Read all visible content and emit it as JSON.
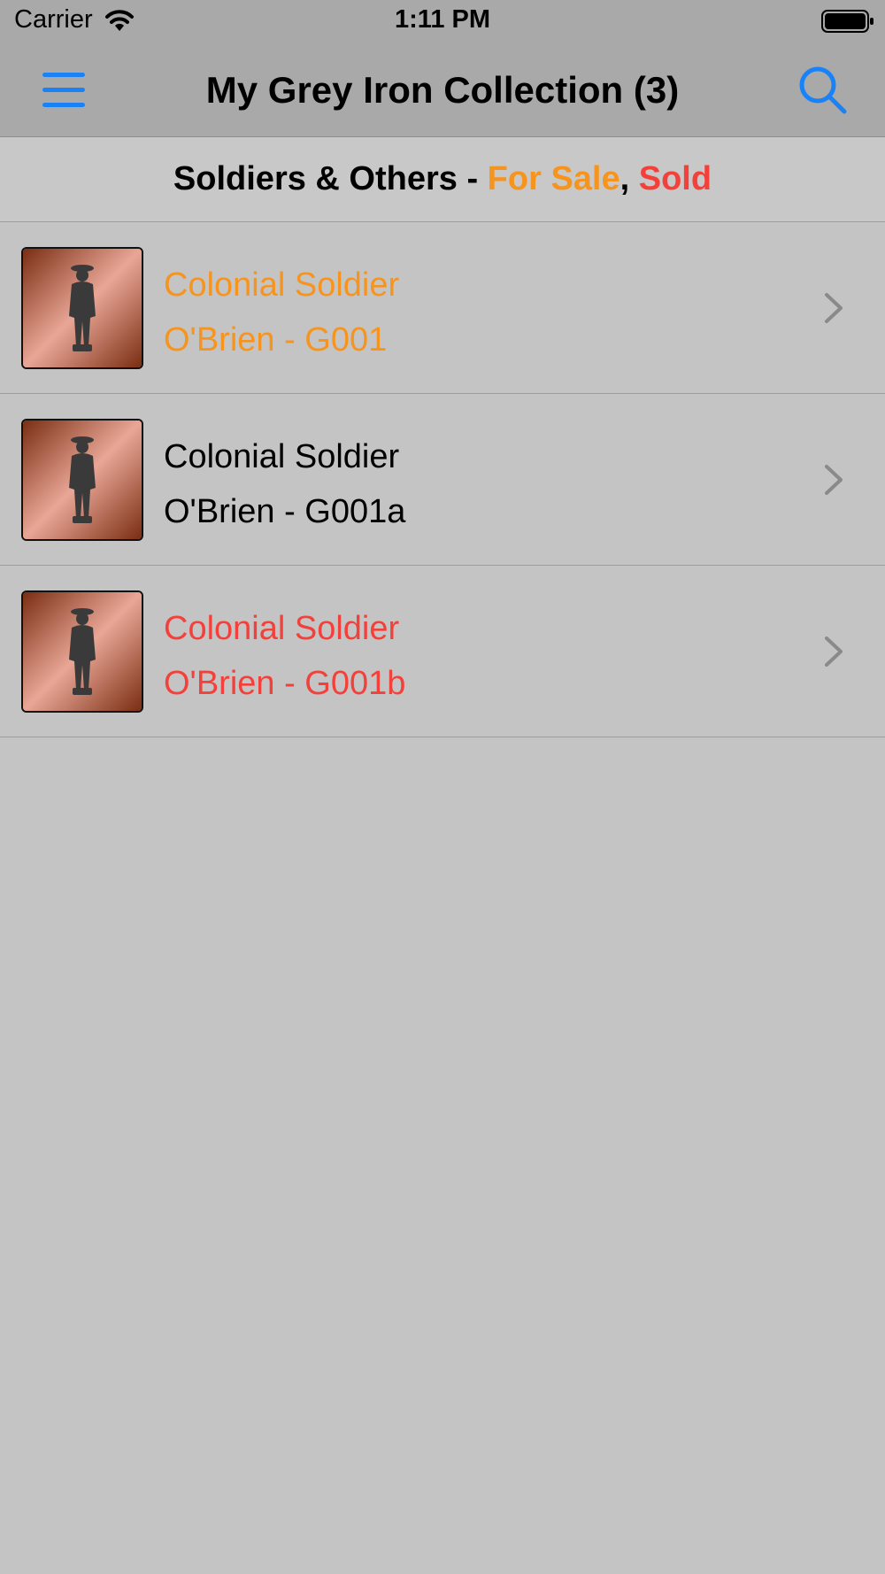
{
  "status_bar": {
    "carrier": "Carrier",
    "time": "1:11 PM"
  },
  "nav": {
    "title": "My Grey Iron Collection (3)",
    "menu_icon": "hamburger-menu-icon",
    "search_icon": "search-icon"
  },
  "section": {
    "prefix": "Soldiers & Others - ",
    "for_sale": "For Sale",
    "separator": ", ",
    "sold": "Sold"
  },
  "colors": {
    "accent_blue": "#1a82f7",
    "for_sale": "#f7941d",
    "sold": "#f4403a",
    "normal": "#000000"
  },
  "items": [
    {
      "name": "Colonial Soldier",
      "subtitle": "O'Brien - G001",
      "status": "for-sale"
    },
    {
      "name": "Colonial Soldier",
      "subtitle": "O'Brien - G001a",
      "status": "normal"
    },
    {
      "name": "Colonial Soldier",
      "subtitle": "O'Brien - G001b",
      "status": "sold"
    }
  ]
}
